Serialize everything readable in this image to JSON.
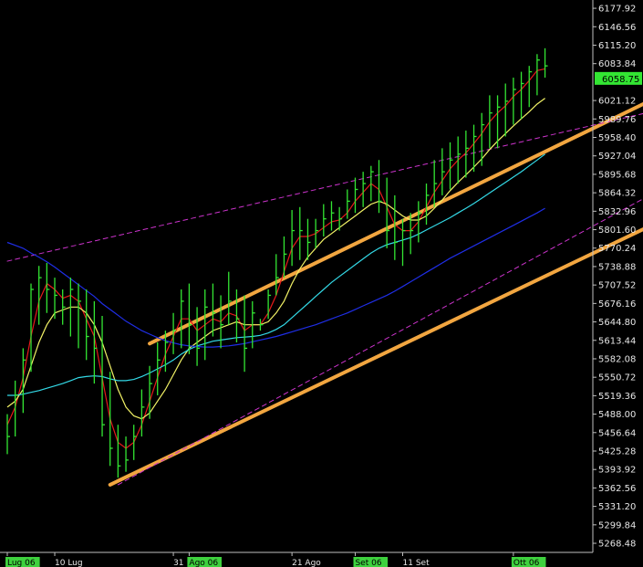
{
  "chart_data": {
    "type": "ohlc",
    "title": "",
    "ylim": [
      5253,
      6192
    ],
    "y_ticks": [
      6177.92,
      6146.56,
      6115.2,
      6083.84,
      6021.12,
      5989.76,
      5958.4,
      5927.04,
      5895.68,
      5864.32,
      5832.96,
      5801.6,
      5770.24,
      5738.88,
      5707.52,
      5676.16,
      5644.8,
      5613.44,
      5582.08,
      5550.72,
      5519.36,
      5488.0,
      5456.64,
      5425.28,
      5393.92,
      5362.56,
      5331.2,
      5299.84,
      5268.48
    ],
    "last_price": "6058.75",
    "x_labels": [
      {
        "text": "Lug 06",
        "bar": 0,
        "highlight": true
      },
      {
        "text": "10 Lug",
        "bar": 6,
        "highlight": false
      },
      {
        "text": "31",
        "bar": 21,
        "highlight": false
      },
      {
        "text": "Ago 06",
        "bar": 23,
        "highlight": true
      },
      {
        "text": "21 Ago",
        "bar": 36,
        "highlight": false
      },
      {
        "text": "Set 06",
        "bar": 44,
        "highlight": true
      },
      {
        "text": "11 Set",
        "bar": 50,
        "highlight": false
      },
      {
        "text": "Ott 06",
        "bar": 64,
        "highlight": true
      }
    ],
    "series": [
      {
        "name": "",
        "color": "#33e633",
        "high": [
          5488,
          5545,
          5600,
          5710,
          5740,
          5745,
          5720,
          5700,
          5720,
          5710,
          5700,
          5680,
          5655,
          5560,
          5470,
          5450,
          5470,
          5530,
          5570,
          5610,
          5630,
          5660,
          5700,
          5710,
          5670,
          5700,
          5710,
          5690,
          5730,
          5700,
          5690,
          5680,
          5650,
          5700,
          5760,
          5790,
          5835,
          5840,
          5820,
          5820,
          5845,
          5850,
          5840,
          5870,
          5890,
          5900,
          5910,
          5920,
          5890,
          5860,
          5820,
          5830,
          5850,
          5880,
          5920,
          5940,
          5950,
          5960,
          5970,
          5980,
          6000,
          6030,
          6030,
          6050,
          6060,
          6070,
          6080,
          6100,
          6110
        ],
        "low": [
          5420,
          5450,
          5490,
          5560,
          5640,
          5660,
          5650,
          5640,
          5620,
          5600,
          5580,
          5540,
          5450,
          5400,
          5380,
          5390,
          5410,
          5450,
          5480,
          5520,
          5560,
          5590,
          5600,
          5590,
          5570,
          5580,
          5620,
          5600,
          5640,
          5610,
          5560,
          5600,
          5630,
          5650,
          5690,
          5720,
          5740,
          5750,
          5750,
          5770,
          5790,
          5800,
          5800,
          5820,
          5830,
          5840,
          5850,
          5830,
          5770,
          5750,
          5740,
          5760,
          5780,
          5810,
          5840,
          5860,
          5870,
          5880,
          5890,
          5900,
          5910,
          5940,
          5940,
          5960,
          5980,
          5990,
          6010,
          6030,
          6060
        ],
        "close": [
          5450,
          5520,
          5580,
          5700,
          5720,
          5700,
          5690,
          5670,
          5700,
          5680,
          5620,
          5600,
          5470,
          5430,
          5400,
          5410,
          5450,
          5500,
          5540,
          5580,
          5610,
          5630,
          5680,
          5640,
          5600,
          5670,
          5660,
          5640,
          5680,
          5650,
          5600,
          5660,
          5640,
          5690,
          5720,
          5760,
          5800,
          5800,
          5780,
          5800,
          5820,
          5830,
          5820,
          5850,
          5870,
          5880,
          5900,
          5850,
          5800,
          5780,
          5800,
          5800,
          5830,
          5860,
          5880,
          5900,
          5920,
          5930,
          5940,
          5960,
          5980,
          6000,
          6010,
          6020,
          6040,
          6050,
          6070,
          6090,
          6080
        ]
      },
      {
        "name": "",
        "color": "#e61a1a",
        "values": [
          5470,
          5500,
          5550,
          5620,
          5680,
          5710,
          5700,
          5685,
          5690,
          5680,
          5650,
          5620,
          5550,
          5480,
          5440,
          5430,
          5440,
          5470,
          5510,
          5550,
          5590,
          5620,
          5650,
          5650,
          5630,
          5640,
          5650,
          5645,
          5660,
          5655,
          5630,
          5640,
          5640,
          5660,
          5690,
          5730,
          5770,
          5790,
          5790,
          5795,
          5805,
          5815,
          5818,
          5830,
          5850,
          5865,
          5880,
          5870,
          5840,
          5810,
          5800,
          5800,
          5815,
          5840,
          5865,
          5885,
          5905,
          5920,
          5932,
          5948,
          5965,
          5985,
          6000,
          6012,
          6028,
          6040,
          6055,
          6072,
          6075
        ]
      },
      {
        "name": "",
        "color": "#f2f266",
        "values": [
          5500,
          5510,
          5530,
          5570,
          5610,
          5640,
          5660,
          5665,
          5670,
          5670,
          5660,
          5640,
          5610,
          5570,
          5530,
          5500,
          5485,
          5480,
          5490,
          5510,
          5530,
          5555,
          5580,
          5600,
          5610,
          5620,
          5630,
          5635,
          5640,
          5645,
          5640,
          5640,
          5640,
          5645,
          5660,
          5680,
          5710,
          5735,
          5755,
          5770,
          5785,
          5795,
          5805,
          5815,
          5825,
          5835,
          5845,
          5850,
          5845,
          5835,
          5825,
          5818,
          5818,
          5825,
          5838,
          5852,
          5868,
          5882,
          5895,
          5908,
          5922,
          5938,
          5952,
          5965,
          5978,
          5990,
          6002,
          6015,
          6025
        ]
      },
      {
        "name": "",
        "color": "#33d9e6",
        "values": [
          5520,
          5520,
          5522,
          5525,
          5528,
          5532,
          5536,
          5540,
          5545,
          5550,
          5552,
          5553,
          5552,
          5548,
          5545,
          5545,
          5547,
          5552,
          5558,
          5565,
          5572,
          5580,
          5590,
          5598,
          5604,
          5608,
          5612,
          5614,
          5616,
          5618,
          5619,
          5620,
          5622,
          5626,
          5632,
          5640,
          5652,
          5664,
          5676,
          5688,
          5700,
          5712,
          5722,
          5732,
          5742,
          5752,
          5762,
          5770,
          5776,
          5780,
          5784,
          5788,
          5794,
          5801,
          5808,
          5815,
          5822,
          5830,
          5838,
          5846,
          5855,
          5864,
          5873,
          5882,
          5891,
          5900,
          5910,
          5920,
          5930
        ]
      },
      {
        "name": "",
        "color": "#1f2ee6",
        "values": [
          5780,
          5775,
          5770,
          5762,
          5755,
          5747,
          5738,
          5728,
          5718,
          5708,
          5698,
          5688,
          5676,
          5666,
          5656,
          5646,
          5638,
          5630,
          5624,
          5618,
          5613,
          5609,
          5606,
          5604,
          5603,
          5602,
          5602,
          5603,
          5604,
          5606,
          5608,
          5611,
          5614,
          5617,
          5620,
          5624,
          5628,
          5632,
          5636,
          5640,
          5645,
          5650,
          5655,
          5660,
          5666,
          5672,
          5678,
          5684,
          5690,
          5697,
          5705,
          5713,
          5721,
          5729,
          5737,
          5745,
          5753,
          5760,
          5767,
          5774,
          5781,
          5788,
          5795,
          5802,
          5809,
          5816,
          5823,
          5830,
          5838
        ]
      }
    ],
    "channel_lines": [
      {
        "color": "#f2a640",
        "style": "solid",
        "from": [
          18,
          5608
        ],
        "to": [
          108,
          6195
        ]
      },
      {
        "color": "#f2a640",
        "style": "solid",
        "from": [
          13,
          5368
        ],
        "to": [
          108,
          5980
        ]
      },
      {
        "color": "#cc33cc",
        "style": "dashed",
        "from": [
          0,
          5748
        ],
        "to": [
          108,
          6085
        ]
      },
      {
        "color": "#cc33cc",
        "style": "dashed",
        "from": [
          14,
          5368
        ],
        "to": [
          108,
          6056
        ]
      }
    ]
  }
}
